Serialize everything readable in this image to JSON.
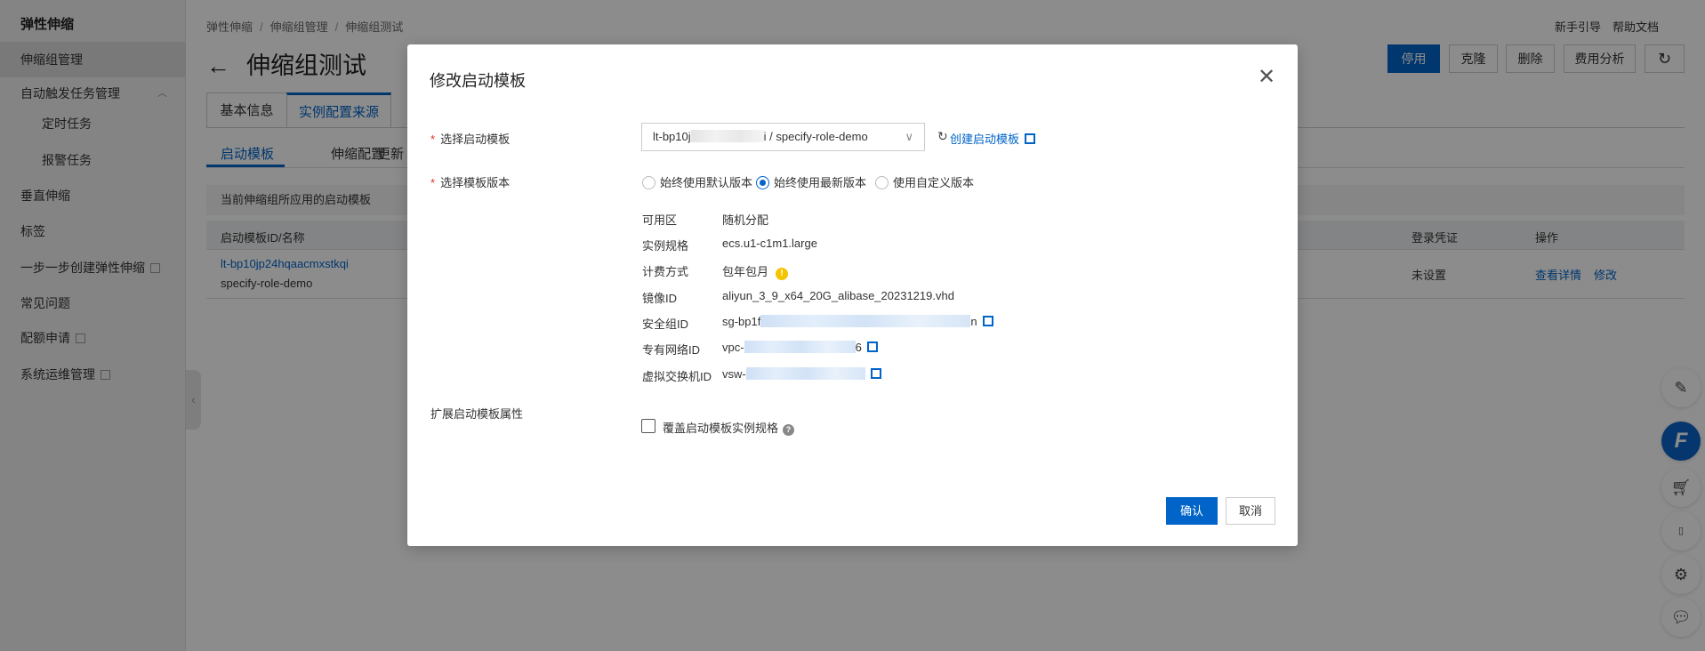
{
  "sidebar": {
    "title": "弹性伸缩",
    "items": [
      {
        "label": "伸缩组管理"
      },
      {
        "label": "自动触发任务管理"
      },
      {
        "label": "定时任务"
      },
      {
        "label": "报警任务"
      },
      {
        "label": "垂直伸缩"
      },
      {
        "label": "标签"
      },
      {
        "label": "一步一步创建弹性伸缩"
      },
      {
        "label": "常见问题"
      },
      {
        "label": "配额申请"
      },
      {
        "label": "系统运维管理"
      }
    ]
  },
  "breadcrumb": [
    "弹性伸缩",
    "伸缩组管理",
    "伸缩组测试"
  ],
  "page_title": "伸缩组测试",
  "top_links": {
    "guide": "新手引导",
    "docs": "帮助文档"
  },
  "toolbar": {
    "disable": "停用",
    "clone": "克隆",
    "delete": "删除",
    "cost": "费用分析"
  },
  "tabs": [
    "基本信息",
    "实例配置来源"
  ],
  "subtabs": [
    "启动模板",
    "伸缩配置",
    "更新"
  ],
  "info_bar": "当前伸缩组所应用的启动模板",
  "table": {
    "headers": {
      "id_name": "启动模板ID/名称",
      "login": "登录凭证",
      "actions": "操作"
    },
    "row": {
      "id": "lt-bp10jp24hqaacmxstkqi",
      "name": "specify-role-demo",
      "login": "未设置",
      "view": "查看详情",
      "edit": "修改"
    }
  },
  "modal": {
    "title": "修改启动模板",
    "template_label": "选择启动模板",
    "template_value_prefix": "lt-bp10j",
    "template_value_suffix": "i / specify-role-demo",
    "create_link": "创建启动模板",
    "version_label": "选择模板版本",
    "versions": [
      "始终使用默认版本",
      "始终使用最新版本",
      "使用自定义版本"
    ],
    "selected_version": 1,
    "details": [
      {
        "label": "可用区",
        "value": "随机分配"
      },
      {
        "label": "实例规格",
        "value": "ecs.u1-c1m1.large"
      },
      {
        "label": "计费方式",
        "value": "包年包月"
      },
      {
        "label": "镜像ID",
        "value": "aliyun_3_9_x64_20G_alibase_20231219.vhd"
      },
      {
        "label": "安全组ID",
        "value_prefix": "sg-bp1f",
        "value_suffix": "n"
      },
      {
        "label": "专有网络ID",
        "value_prefix": "vpc-",
        "value_suffix": "6"
      },
      {
        "label": "虚拟交换机ID",
        "value_prefix": "vsw-",
        "value_suffix": ""
      }
    ],
    "extend_label": "扩展启动模板属性",
    "override_label": "覆盖启动模板实例规格",
    "override_checked": false,
    "confirm": "确认",
    "cancel": "取消"
  },
  "colors": {
    "primary": "#0064c8",
    "warning": "#f5c400"
  }
}
